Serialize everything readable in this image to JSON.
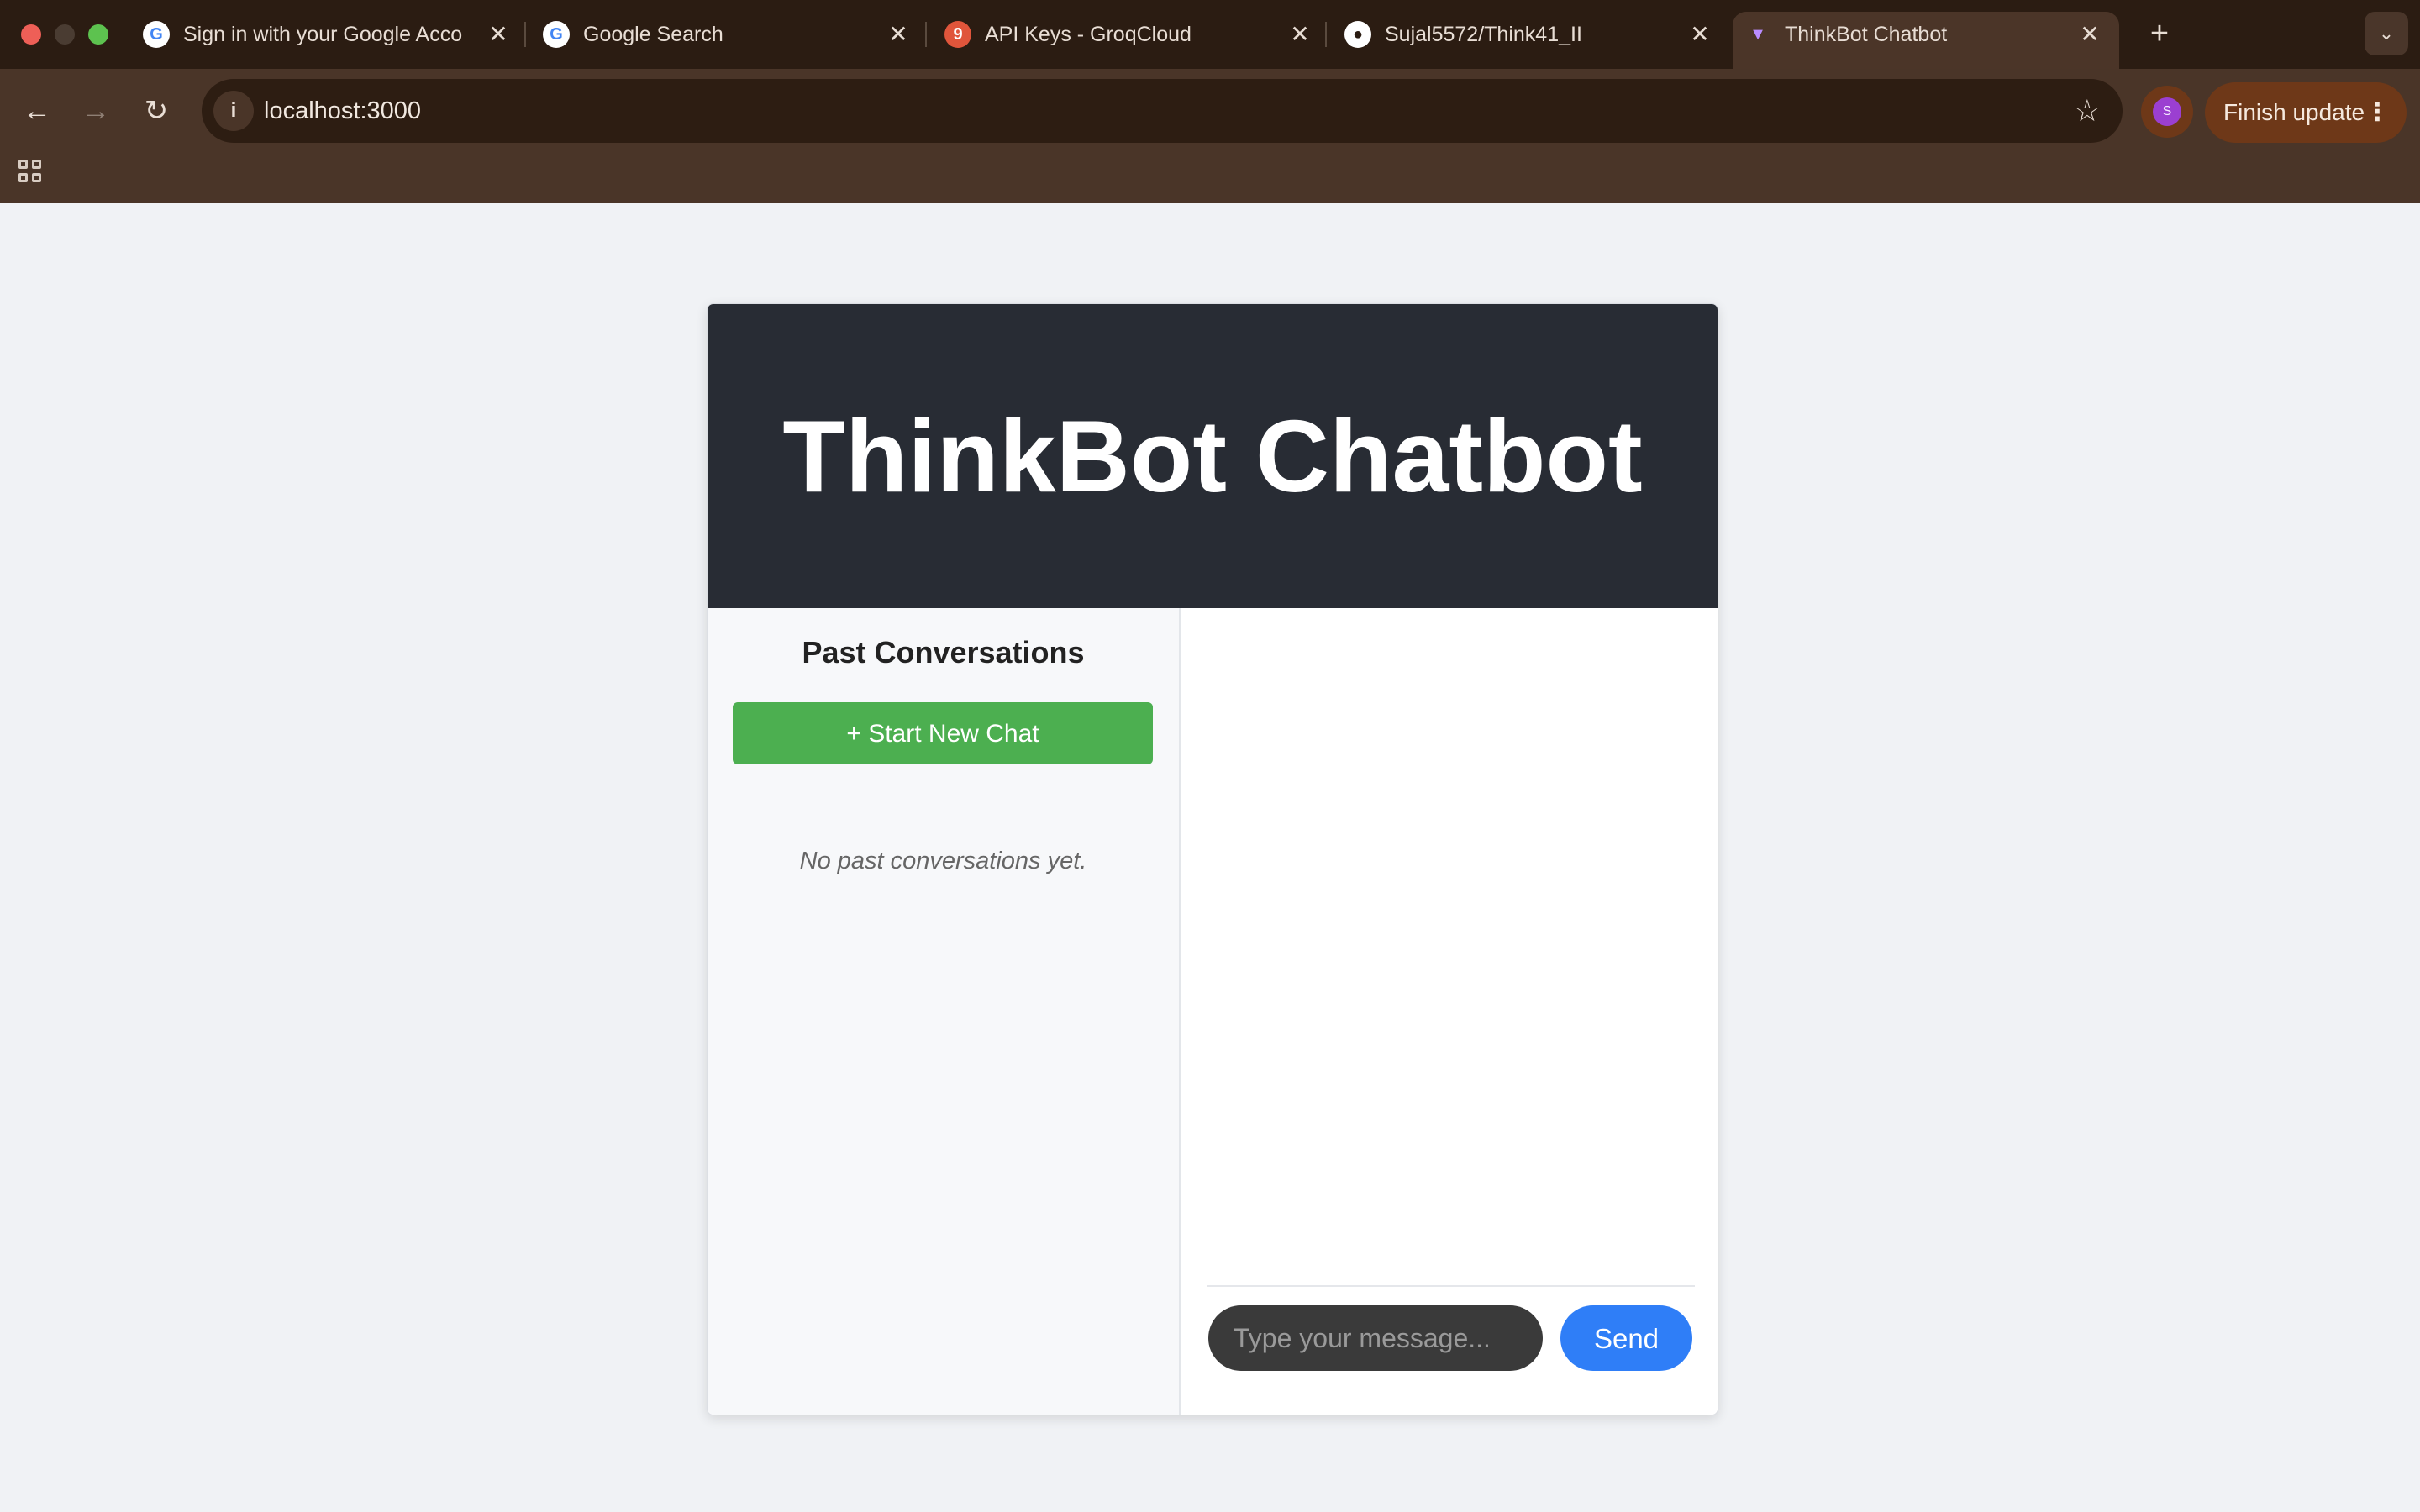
{
  "browser": {
    "tabs": [
      {
        "title": "Sign in with your Google Acco",
        "favicon": "google-g-icon",
        "favicon_glyph": "G",
        "active": false
      },
      {
        "title": "Google Search",
        "favicon": "google-g-icon",
        "favicon_glyph": "G",
        "active": false
      },
      {
        "title": "API Keys - GroqCloud",
        "favicon": "groq-icon",
        "favicon_glyph": "9",
        "active": false
      },
      {
        "title": "Sujal5572/Think41_II",
        "favicon": "github-icon",
        "favicon_glyph": "●",
        "active": false
      },
      {
        "title": "ThinkBot Chatbot",
        "favicon": "vite-icon",
        "favicon_glyph": "▼",
        "active": true
      }
    ],
    "tab_close_glyph": "✕",
    "new_tab_glyph": "+",
    "tab_menu_glyph": "⌄",
    "address": "localhost:3000",
    "info_glyph": "i",
    "star_glyph": "☆",
    "profile_initial": "S",
    "finish_update_label": "Finish update",
    "menu_glyph": "⋮",
    "back_glyph": "←",
    "forward_glyph": "→",
    "reload_glyph": "↻"
  },
  "app": {
    "title": "ThinkBot Chatbot",
    "sidebar": {
      "heading": "Past Conversations",
      "new_chat_label": "+ Start New Chat",
      "empty_message": "No past conversations yet."
    },
    "chat": {
      "input_placeholder": "Type your message...",
      "send_label": "Send"
    }
  },
  "colors": {
    "header_bg": "#282c34",
    "new_chat_green": "#4caf50",
    "send_blue": "#2f7ef7",
    "browser_frame": "#4a3528"
  }
}
